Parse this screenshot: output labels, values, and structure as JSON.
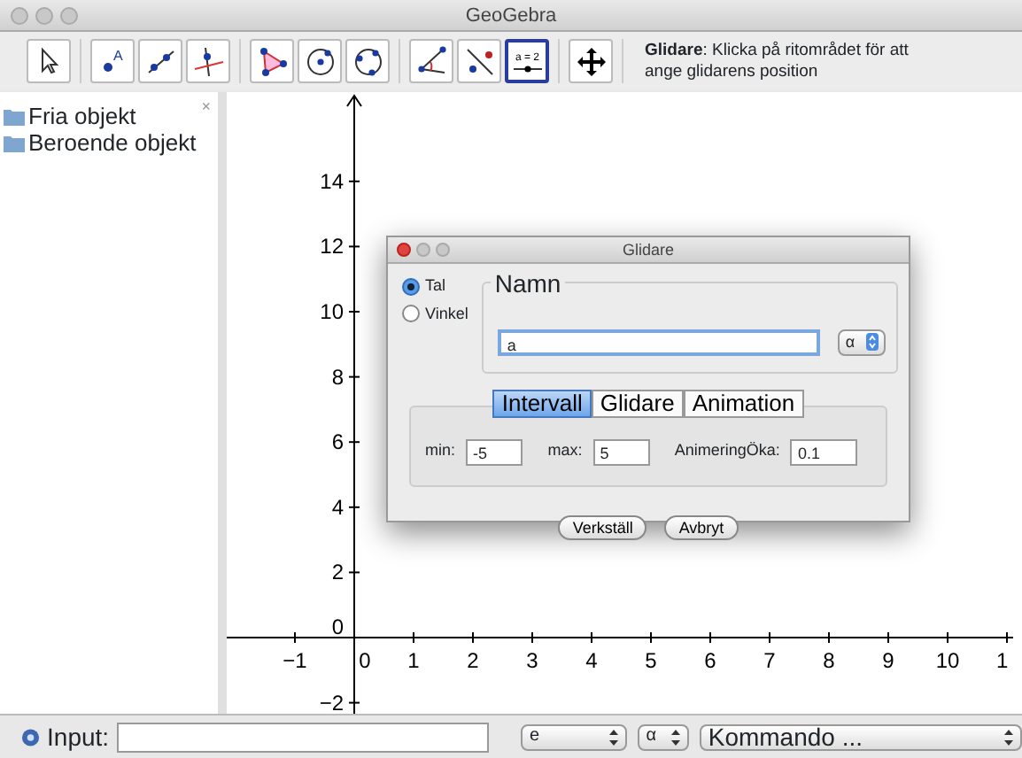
{
  "window": {
    "title": "GeoGebra"
  },
  "toolbar": {
    "groups": [
      [
        {
          "kind": "pointer",
          "selected": false
        }
      ],
      [
        {
          "kind": "point",
          "selected": false,
          "glyph": "A"
        },
        {
          "kind": "line",
          "selected": false
        },
        {
          "kind": "perpendicular",
          "selected": false
        }
      ],
      [
        {
          "kind": "polygon",
          "selected": false
        },
        {
          "kind": "circle",
          "selected": false
        },
        {
          "kind": "circle3",
          "selected": false
        }
      ],
      [
        {
          "kind": "angle",
          "selected": false
        },
        {
          "kind": "reflect",
          "selected": false
        },
        {
          "kind": "slider",
          "selected": true,
          "glyph": "a = 2"
        }
      ],
      [
        {
          "kind": "move",
          "selected": false
        }
      ]
    ],
    "help": "**Glidare**: Klicka på ritområdet för att ange glidarens position"
  },
  "algebra": {
    "close": "×",
    "items": [
      {
        "label": "Fria objekt"
      },
      {
        "label": "Beroende objekt"
      }
    ]
  },
  "graphics": {
    "x_labels": [
      "−1",
      "0",
      "1",
      "2",
      "3",
      "4",
      "5",
      "6",
      "7",
      "8",
      "9",
      "10",
      "1"
    ],
    "y_labels": [
      "14",
      "12",
      "10",
      "8",
      "6",
      "4",
      "2",
      "0",
      "−2"
    ]
  },
  "dialog": {
    "title": "Glidare",
    "radios": [
      {
        "label": "Tal",
        "selected": true
      },
      {
        "label": "Vinkel",
        "selected": false
      }
    ],
    "name_legend": "Namn",
    "name_value": "a",
    "symbol": "α",
    "tabs": [
      {
        "label": "Intervall",
        "selected": true
      },
      {
        "label": "Glidare",
        "selected": false
      },
      {
        "label": "Animation",
        "selected": false
      }
    ],
    "fields": [
      {
        "label": "min:",
        "value": "-5"
      },
      {
        "label": "max:",
        "value": "5"
      },
      {
        "label": "AnimeringÖka:",
        "value": "0.1"
      }
    ],
    "buttons": [
      "Verkställ",
      "Avbryt"
    ]
  },
  "input_bar": {
    "label": "Input:",
    "selects": [
      "e",
      "α",
      "Kommando ..."
    ]
  }
}
